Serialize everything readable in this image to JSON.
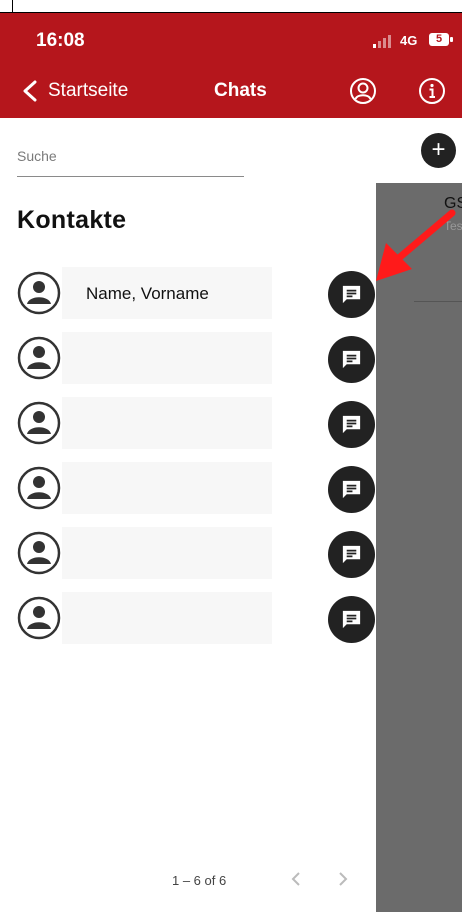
{
  "status_bar": {
    "time": "16:08",
    "network": "4G",
    "battery": "5"
  },
  "nav": {
    "back_label": "Startseite",
    "title": "Chats",
    "profile_icon": "user-circle-icon",
    "info_icon": "info-circle-icon"
  },
  "search": {
    "placeholder": "Suche",
    "value": ""
  },
  "add_button": {
    "label": "+"
  },
  "section": {
    "heading": "Kontakte"
  },
  "contacts": [
    {
      "name": "Name, Vorname"
    },
    {
      "name": ""
    },
    {
      "name": ""
    },
    {
      "name": ""
    },
    {
      "name": ""
    },
    {
      "name": ""
    }
  ],
  "background_list": {
    "title": "GS",
    "subtitle": "Tes"
  },
  "pagination": {
    "range": "1 – 6 of 6"
  },
  "colors": {
    "brand_red": "#b5161c",
    "dark": "#222222",
    "overlay": "#6b6b6b",
    "arrow_red": "#ff1a1a"
  }
}
